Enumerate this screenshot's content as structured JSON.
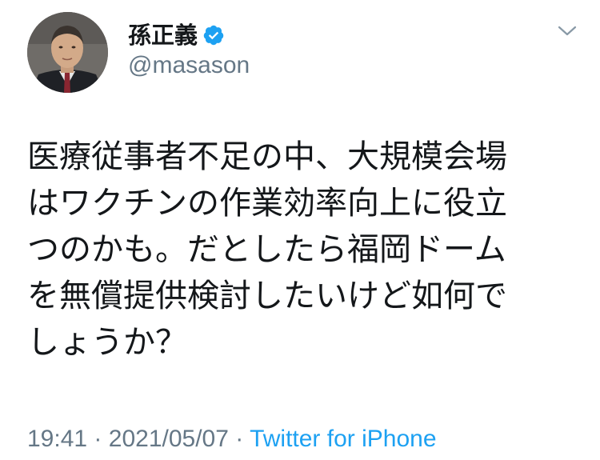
{
  "author": {
    "display_name": "孫正義",
    "handle": "@masason",
    "verified": true
  },
  "tweet": {
    "text_lines": [
      "医療従事者不足の中、大規模会場",
      "はワクチンの作業効率向上に役立",
      "つのかも。だとしたら福岡ドーム",
      "を無償提供検討したいけど如何で",
      "しょうか？"
    ],
    "time": "19:41",
    "separator": "·",
    "date": "2021/05/07",
    "source": "Twitter for iPhone"
  },
  "colors": {
    "text": "#14171a",
    "secondary": "#657786",
    "link": "#1da1f2",
    "verified_badge": "#1da1f2"
  },
  "icons": {
    "verified": "verified-badge-icon",
    "more": "chevron-down-icon"
  }
}
